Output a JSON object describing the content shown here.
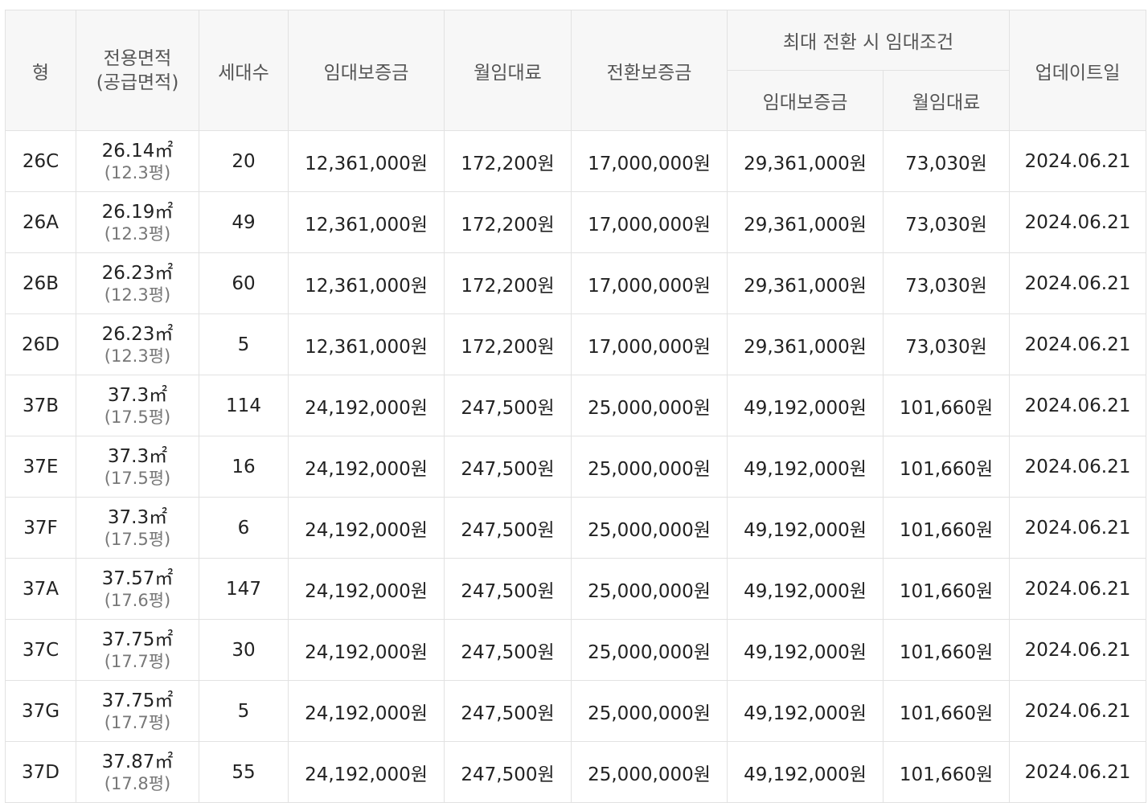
{
  "header": {
    "type": "형",
    "area_line1": "전용면적",
    "area_line2": "(공급면적)",
    "households": "세대수",
    "deposit": "임대보증금",
    "rent": "월임대료",
    "conversion_deposit": "전환보증금",
    "max_conversion": "최대 전환 시 임대조건",
    "max_deposit": "임대보증금",
    "max_rent": "월임대료",
    "updated": "업데이트일"
  },
  "unit_m2": "㎡",
  "rows": [
    {
      "type": "26C",
      "area": "26.14",
      "supply": "(12.3평)",
      "households": "20",
      "deposit": "12,361,000원",
      "rent": "172,200원",
      "conversion": "17,000,000원",
      "max_deposit": "29,361,000원",
      "max_rent": "73,030원",
      "updated": "2024.06.21"
    },
    {
      "type": "26A",
      "area": "26.19",
      "supply": "(12.3평)",
      "households": "49",
      "deposit": "12,361,000원",
      "rent": "172,200원",
      "conversion": "17,000,000원",
      "max_deposit": "29,361,000원",
      "max_rent": "73,030원",
      "updated": "2024.06.21"
    },
    {
      "type": "26B",
      "area": "26.23",
      "supply": "(12.3평)",
      "households": "60",
      "deposit": "12,361,000원",
      "rent": "172,200원",
      "conversion": "17,000,000원",
      "max_deposit": "29,361,000원",
      "max_rent": "73,030원",
      "updated": "2024.06.21"
    },
    {
      "type": "26D",
      "area": "26.23",
      "supply": "(12.3평)",
      "households": "5",
      "deposit": "12,361,000원",
      "rent": "172,200원",
      "conversion": "17,000,000원",
      "max_deposit": "29,361,000원",
      "max_rent": "73,030원",
      "updated": "2024.06.21"
    },
    {
      "type": "37B",
      "area": "37.3",
      "supply": "(17.5평)",
      "households": "114",
      "deposit": "24,192,000원",
      "rent": "247,500원",
      "conversion": "25,000,000원",
      "max_deposit": "49,192,000원",
      "max_rent": "101,660원",
      "updated": "2024.06.21"
    },
    {
      "type": "37E",
      "area": "37.3",
      "supply": "(17.5평)",
      "households": "16",
      "deposit": "24,192,000원",
      "rent": "247,500원",
      "conversion": "25,000,000원",
      "max_deposit": "49,192,000원",
      "max_rent": "101,660원",
      "updated": "2024.06.21"
    },
    {
      "type": "37F",
      "area": "37.3",
      "supply": "(17.5평)",
      "households": "6",
      "deposit": "24,192,000원",
      "rent": "247,500원",
      "conversion": "25,000,000원",
      "max_deposit": "49,192,000원",
      "max_rent": "101,660원",
      "updated": "2024.06.21"
    },
    {
      "type": "37A",
      "area": "37.57",
      "supply": "(17.6평)",
      "households": "147",
      "deposit": "24,192,000원",
      "rent": "247,500원",
      "conversion": "25,000,000원",
      "max_deposit": "49,192,000원",
      "max_rent": "101,660원",
      "updated": "2024.06.21"
    },
    {
      "type": "37C",
      "area": "37.75",
      "supply": "(17.7평)",
      "households": "30",
      "deposit": "24,192,000원",
      "rent": "247,500원",
      "conversion": "25,000,000원",
      "max_deposit": "49,192,000원",
      "max_rent": "101,660원",
      "updated": "2024.06.21"
    },
    {
      "type": "37G",
      "area": "37.75",
      "supply": "(17.7평)",
      "households": "5",
      "deposit": "24,192,000원",
      "rent": "247,500원",
      "conversion": "25,000,000원",
      "max_deposit": "49,192,000원",
      "max_rent": "101,660원",
      "updated": "2024.06.21"
    },
    {
      "type": "37D",
      "area": "37.87",
      "supply": "(17.8평)",
      "households": "55",
      "deposit": "24,192,000원",
      "rent": "247,500원",
      "conversion": "25,000,000원",
      "max_deposit": "49,192,000원",
      "max_rent": "101,660원",
      "updated": "2024.06.21"
    }
  ]
}
